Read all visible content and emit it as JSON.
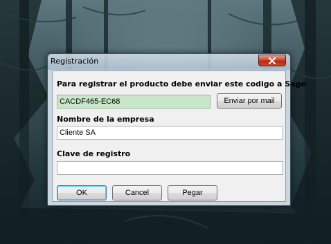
{
  "dialog": {
    "title": "Registración",
    "intro_text": "Para registrar el producto debe enviar este codigo a Sage",
    "code_value": "CACDF465-EC68",
    "send_mail_label": "Enviar por mail",
    "company_label": "Nombre de la empresa",
    "company_value": "Cliente SA",
    "key_label": "Clave de registro",
    "key_value": "",
    "ok_label": "OK",
    "cancel_label": "Cancel",
    "paste_label": "Pegar"
  },
  "colors": {
    "code_field_bg": "#c8e6c8",
    "close_button": "#c8452a",
    "default_button_border": "#3c7fb1"
  },
  "icons": {
    "close": "close-icon"
  }
}
